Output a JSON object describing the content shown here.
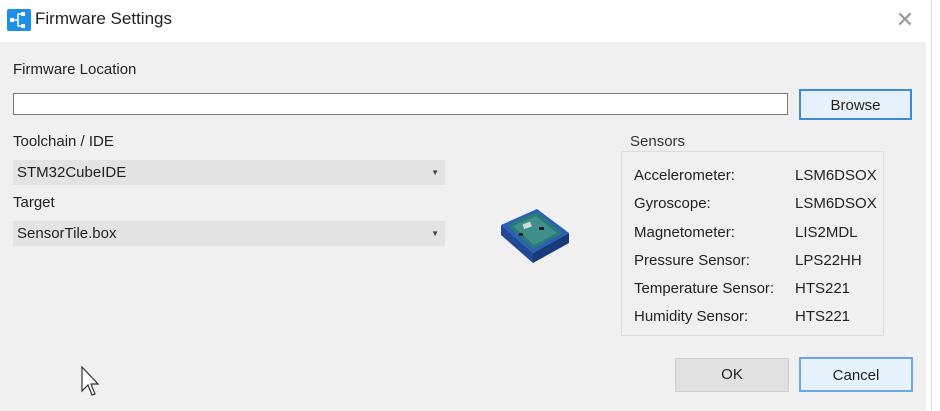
{
  "window": {
    "title": "Firmware Settings",
    "icon": "app-network-icon",
    "close_icon": "close-icon"
  },
  "firmware": {
    "label": "Firmware Location",
    "value": "",
    "browse_label": "Browse"
  },
  "toolchain": {
    "label": "Toolchain / IDE",
    "selected": "STM32CubeIDE"
  },
  "target": {
    "label": "Target",
    "selected": "SensorTile.box"
  },
  "sensors": {
    "title": "Sensors",
    "items": [
      {
        "name": "Accelerometer:",
        "value": "LSM6DSOX"
      },
      {
        "name": "Gyroscope:",
        "value": "LSM6DSOX"
      },
      {
        "name": "Magnetometer:",
        "value": "LIS2MDL"
      },
      {
        "name": "Pressure Sensor:",
        "value": "LPS22HH"
      },
      {
        "name": "Temperature Sensor:",
        "value": "HTS221"
      },
      {
        "name": "Humidity Sensor:",
        "value": "HTS221"
      }
    ]
  },
  "buttons": {
    "ok": "OK",
    "cancel": "Cancel"
  },
  "colors": {
    "accent": "#1e8fe6",
    "focus_border": "#3c8ad8",
    "dialog_bg": "#f0f0f0"
  }
}
